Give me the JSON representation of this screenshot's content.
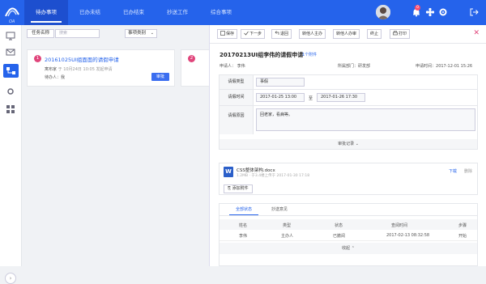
{
  "app": {
    "logo_text": "OA"
  },
  "nav": {
    "tabs": [
      "待办事项",
      "已办未结",
      "已办结束",
      "抄送工作",
      "综合事项"
    ],
    "badge_count": "0"
  },
  "filter": {
    "label": "任务名称",
    "placeholder": "搜索",
    "select": "事项类别"
  },
  "cards": [
    {
      "num": "1",
      "title": "20161025UI组面面的请假申请",
      "applicant_label": "寓布家",
      "time_gray": "于 10月24日 10:05 发起申请",
      "handler_label": "待办人：",
      "handler": "我",
      "action": "审批"
    },
    {
      "num": "2",
      "title": "",
      "applicant_label": "",
      "time_gray": "",
      "handler_label": "",
      "handler": "",
      "action": ""
    }
  ],
  "panel": {
    "toolbar": [
      "保存",
      "下一步",
      "退回",
      "转他人主办",
      "转他人办审",
      "终止",
      "打印"
    ],
    "title": "20170213UI组李伟的请假申请",
    "attachment_count": "1个附件",
    "applicant_label": "申请人：",
    "applicant": "李伟",
    "dept_label": "所属部门：",
    "dept": "研发部",
    "date_label": "申请时间：",
    "date": "2017-12-01 15:26",
    "form": {
      "type_label": "请假类型",
      "type_value": "事假",
      "time_label": "请假时间",
      "time_start": "2017-01-25 13:00",
      "time_sep": "至",
      "time_end": "2017-01-26 17:30",
      "reason_label": "请假原因",
      "reason_value": "回老家，看病等。",
      "footer": "审批记录"
    },
    "attachment": {
      "icon": "W",
      "name": "CSS整体架构.docx",
      "meta": "1.2MB · 于3.4楼上传于 2017-01-30 17:18",
      "download": "下载",
      "delete": "删除",
      "add": "添加附件"
    },
    "flow": {
      "tabs": [
        "全部状态",
        "抄送意见"
      ],
      "headers": [
        "姓名",
        "类型",
        "状态",
        "查阅时间",
        "步骤"
      ],
      "rows": [
        [
          "李伟",
          "主办人",
          "已撤阅",
          "2017-02-13 08:32:58",
          "开始"
        ]
      ],
      "footer": "收起"
    }
  }
}
